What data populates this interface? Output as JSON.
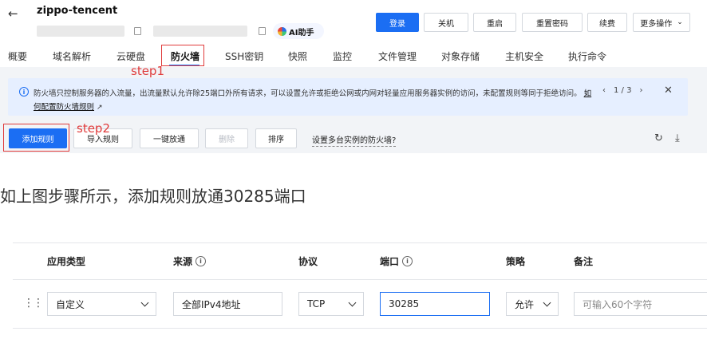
{
  "header": {
    "back_icon": "arrow-left-icon",
    "title": "zippo-tencent",
    "ai_assistant_label": "AI助手",
    "buttons": {
      "login": "登录",
      "shutdown": "关机",
      "restart": "重启",
      "reset_password": "重置密码",
      "renew": "续费",
      "more_actions": "更多操作"
    }
  },
  "tabs": [
    {
      "label": "概要"
    },
    {
      "label": "域名解析"
    },
    {
      "label": "云硬盘"
    },
    {
      "label": "防火墙",
      "active": true
    },
    {
      "label": "SSH密钥"
    },
    {
      "label": "快照"
    },
    {
      "label": "监控"
    },
    {
      "label": "文件管理"
    },
    {
      "label": "对象存储"
    },
    {
      "label": "主机安全"
    },
    {
      "label": "执行命令"
    }
  ],
  "annotations": {
    "step1": "step1",
    "step2": "step2",
    "color": "#e03b3b"
  },
  "banner": {
    "icon": "info-icon",
    "text": "防火墙只控制服务器的入流量，出流量默认允许除25端口外所有请求，可以设置允许或拒绝公网或内网对轻量应用服务器实例的访问，未配置规则等同于拒绝访问。",
    "link": "如何配置防火墙规则",
    "pager": "1 / 3"
  },
  "toolbar": {
    "add_rule": "添加规则",
    "import_rules": "导入规则",
    "one_click_open": "一键放通",
    "delete": "删除",
    "sort": "排序",
    "multi_instance_link": "设置多台实例的防火墙?",
    "refresh_icon": "refresh-icon",
    "download_icon": "download-icon"
  },
  "instruction": "如上图步骤所示，添加规则放通30285端口",
  "rule_table": {
    "headers": {
      "app_type": "应用类型",
      "source": "来源",
      "protocol": "协议",
      "port": "端口",
      "policy": "策略",
      "remark": "备注"
    },
    "row": {
      "app_type": "自定义",
      "source": "全部IPv4地址",
      "protocol": "TCP",
      "port": "30285",
      "policy": "允许",
      "remark_placeholder": "可输入60个字符"
    }
  },
  "colors": {
    "primary": "#1b6ef3",
    "banner_bg": "#e6efff",
    "annotation_red": "#e03b3b"
  }
}
